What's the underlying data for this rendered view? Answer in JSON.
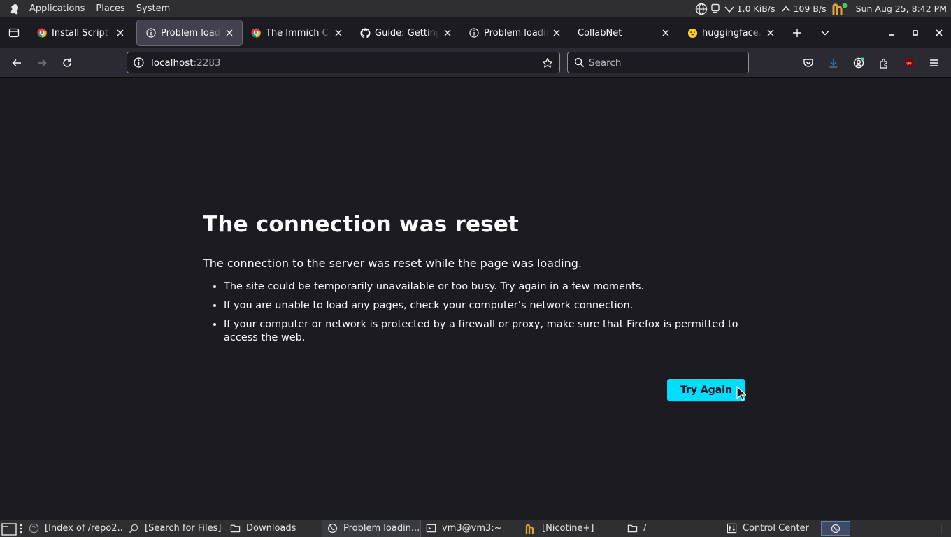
{
  "top_panel": {
    "menus": [
      "Applications",
      "Places",
      "System"
    ],
    "net_down": "1.0 KiB/s",
    "net_up": "109 B/s",
    "clock": "Sun Aug 25,  8:42 PM",
    "icons": [
      "gnome-foot-icon",
      "globe-icon",
      "network-monitor-icon",
      "wifi-icon",
      "upload-icon",
      "nicotine-icon"
    ]
  },
  "tabs": [
    {
      "title": "Install Script [Ex",
      "icon": "chrome-icon",
      "active": false
    },
    {
      "title": "Problem loading",
      "icon": "info-icon",
      "active": true
    },
    {
      "title": "The Immich CLI |",
      "icon": "chrome-icon",
      "active": false
    },
    {
      "title": "Guide: Getting st",
      "icon": "github-icon",
      "active": false
    },
    {
      "title": "Problem loading",
      "icon": "info-icon",
      "active": false
    },
    {
      "title": "CollabNet",
      "icon": "none",
      "active": false
    },
    {
      "title": "huggingface.co/",
      "icon": "huggingface-icon",
      "active": false
    }
  ],
  "nav": {
    "url_host": "localhost",
    "url_port": ":2283",
    "search_placeholder": "Search"
  },
  "error": {
    "title": "The connection was reset",
    "description": "The connection to the server was reset while the page was loading.",
    "bullets": [
      "The site could be temporarily unavailable or too busy. Try again in a few moments.",
      "If you are unable to load any pages, check your computer’s network connection.",
      "If your computer or network is protected by a firewall or proxy, make sure that Firefox is permitted to access the web."
    ],
    "button_label": "Try Again"
  },
  "taskbar": [
    {
      "label": "[Index of /repo2...",
      "icon": "web-icon"
    },
    {
      "label": "[Search for Files]",
      "icon": "search-files-icon"
    },
    {
      "label": "Downloads",
      "icon": "folder-icon"
    },
    {
      "label": "Problem loadin...",
      "icon": "firefox-icon",
      "active": true
    },
    {
      "label": "vm3@vm3:~",
      "icon": "terminal-icon"
    },
    {
      "label": "[Nicotine+]",
      "icon": "nicotine-icon"
    },
    {
      "label": "/",
      "icon": "folder-icon"
    },
    {
      "label": "Control Center",
      "icon": "control-center-icon"
    }
  ],
  "colors": {
    "accent": "#00ddff",
    "background": "#1c1b22",
    "toolbar": "#2b2a33"
  }
}
